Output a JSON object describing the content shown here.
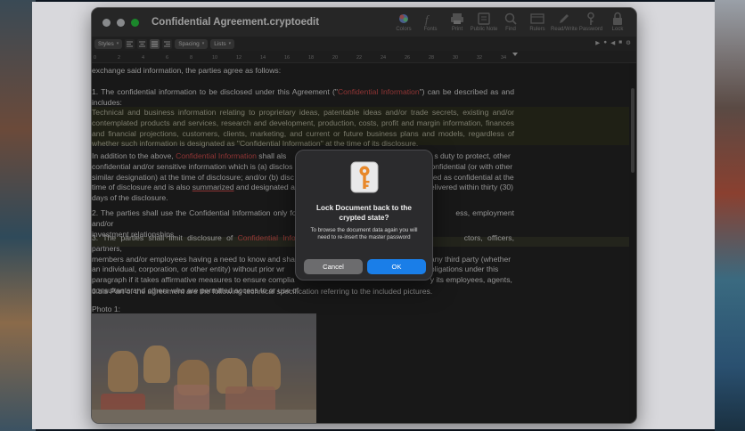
{
  "window": {
    "title": "Confidential Agreement.cryptoedit"
  },
  "toolbar": {
    "items": [
      {
        "label": "Colors",
        "icon": "colors-icon"
      },
      {
        "label": "Fonts",
        "icon": "fonts-icon"
      },
      {
        "label": "Print",
        "icon": "print-icon"
      },
      {
        "label": "Public Note",
        "icon": "note-icon"
      },
      {
        "label": "Find",
        "icon": "find-icon"
      },
      {
        "label": "Rulers",
        "icon": "rulers-icon"
      },
      {
        "label": "Read/Write",
        "icon": "pencil-icon"
      },
      {
        "label": "Password",
        "icon": "key-icon"
      },
      {
        "label": "Lock",
        "icon": "lock-icon"
      }
    ]
  },
  "formatbar": {
    "styles": "Styles",
    "spacing": "Spacing",
    "lists": "Lists"
  },
  "ruler": {
    "ticks": [
      "0",
      "2",
      "4",
      "6",
      "8",
      "10",
      "12",
      "14",
      "16",
      "18",
      "20",
      "22",
      "24",
      "26",
      "28",
      "30",
      "32",
      "34"
    ]
  },
  "document": {
    "p0": "exchange said information, the parties agree as follows:",
    "p1_a": "1. The confidential information to be disclosed under this Agreement (\"",
    "p1_red": "Confidential Information",
    "p1_b": "\") can be described as and includes:",
    "p2": "Technical and business information relating to proprietary ideas, patentable ideas and/or trade secrets, existing and/or contemplated products and services, research and development, production, costs, profit and margin information, finances and financial projections, customers, clients, marketing, and current or future business plans and models, regardless of whether such information is designated as \"Confidential Information\" at the time of its disclosure.",
    "p3_a": "In addition to the above, ",
    "p3_red": "Confidential Information",
    "p3_b": " shall als",
    "p3_c": "s duty to protect, other",
    "p3_line2a": "confidential and/or sensitive information which is (a) disclos",
    "p3_line2b": "onfidential (or with other",
    "p3_line3a": "similar designation) at the time of disclosure; and/or (b) disc",
    "p3_line3b": "ed as confidential at the",
    "p3_line4a": "time of disclosure and is also ",
    "p3_underline": "summarized",
    "p3_line4b": " and designated a",
    "p3_line4c": "elivered within thirty (30)",
    "p3_line5": "days of the disclosure.",
    "p4_a": "2. The parties shall use the Confidential Information only for",
    "p4_b": "ess, employment and/or",
    "p4_line2": "investment relationships.",
    "p5_a": "3. The parties shall limit disclosure of ",
    "p5_red": "Confidential Informati",
    "p5_b": "ctors, officers, partners,",
    "p5_line2a": "members and/or employees having a need to know and sha",
    "p5_line2b": "any third party (whether",
    "p5_line3a": "an individual, corporation, or other entity) without prior wr",
    "p5_line3b": "s obligations under this",
    "p5_line4a": "paragraph if it takes affirmative measures to ensure complia",
    "p5_line4b": "y its employees, agents,",
    "p5_line5": "consultants and others who are permitted access to or use of",
    "p6": "3.bis  Part of the agreement are the following technical specification referring to the included pictures.",
    "p7": "Photo 1:"
  },
  "dialog": {
    "title": "Lock Document back to the crypted state?",
    "message": "To browse the document data again you will need to re-insert the master password",
    "cancel": "Cancel",
    "ok": "OK"
  },
  "colors": {
    "accent": "#1a7ee8",
    "red_text": "#d24d4d"
  }
}
